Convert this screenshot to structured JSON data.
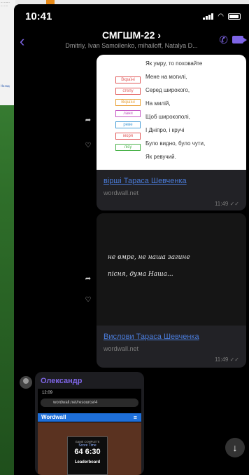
{
  "background_doc": [
    "... ......",
    "... ....",
    "Назад"
  ],
  "status_bar": {
    "time": "10:41"
  },
  "header": {
    "title": "СМГШМ-22 ›",
    "members": "Dmitriy, Ivan Samoilenko, mihailoff, Natalya D..."
  },
  "message1": {
    "poem_lines": [
      "Як умру, то поховайте",
      "Мене на могилі,",
      "Серед широкого,",
      "На милій,",
      "Щоб широкополі,",
      "І Дніпро, і кручі",
      "Було видно, було чути,",
      "Як ревучий."
    ],
    "words": [
      "Вкраїні",
      "степу",
      "Вкраїні",
      "лани",
      "ревe",
      "моря",
      "лісу"
    ],
    "link_title": "вірші Тараса Шевченка",
    "domain": "wordwall.net",
    "time": "11:49 ✓✓"
  },
  "message2": {
    "hand_lines": [
      "не вмре, не наша загине",
      "пісня, дума Наша..."
    ],
    "link_title": "Вислови Тараса Шевченка",
    "domain": "wordwall.net",
    "time": "11:49 ✓✓"
  },
  "message3": {
    "sender": "Олександр",
    "screenshot": {
      "status": "12:09",
      "url": "wordwall.net/resource/4",
      "brand": "Wordwall",
      "game_complete": "GAME COMPLETE",
      "labels": "Score   Time",
      "numbers": "64 6:30",
      "leaderboard": "Leaderboard"
    }
  },
  "colors": {
    "accent": "#7e65e6",
    "link": "#4a7bd8",
    "bubble": "#222226"
  }
}
